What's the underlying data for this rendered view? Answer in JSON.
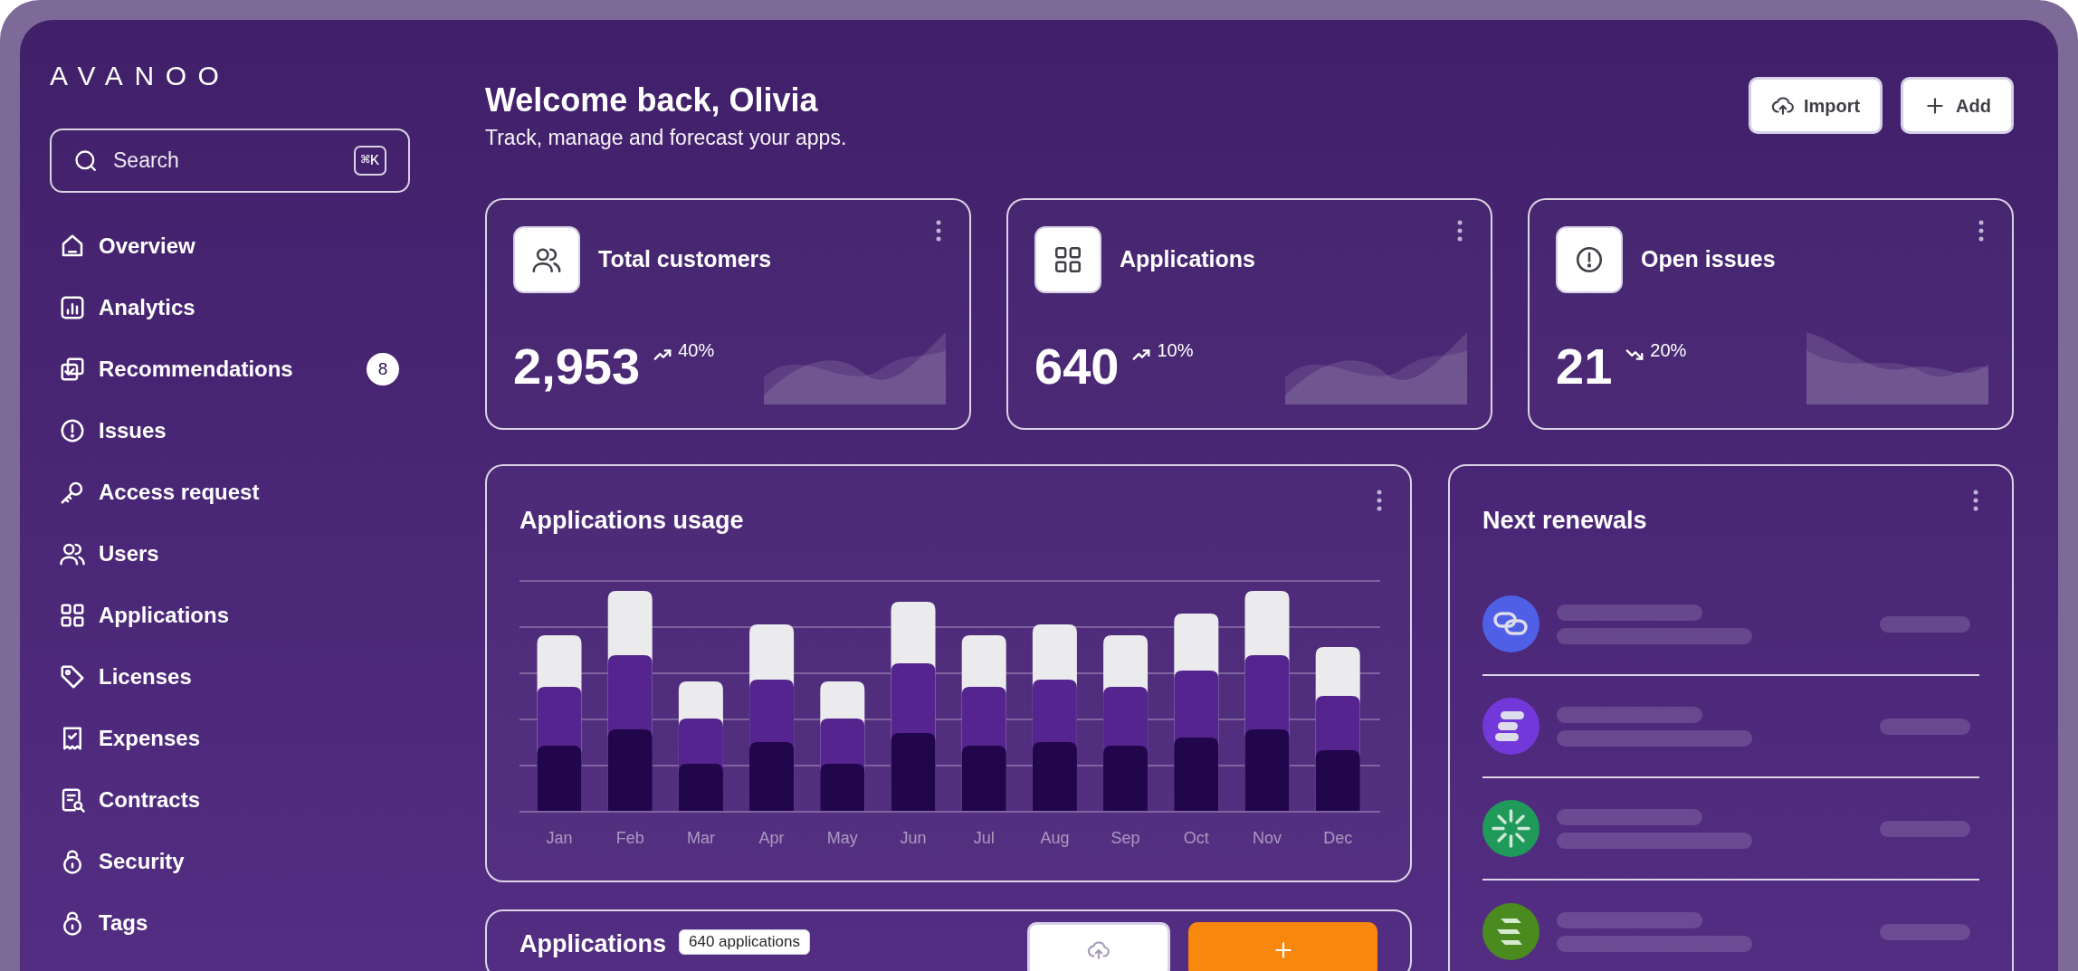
{
  "logo": "AVANOO",
  "search": {
    "placeholder": "Search",
    "shortcut": "⌘K"
  },
  "nav": [
    {
      "label": "Overview"
    },
    {
      "label": "Analytics"
    },
    {
      "label": "Recommendations",
      "badge": "8"
    },
    {
      "label": "Issues"
    },
    {
      "label": "Access request"
    },
    {
      "label": "Users"
    },
    {
      "label": "Applications"
    },
    {
      "label": "Licenses"
    },
    {
      "label": "Expenses"
    },
    {
      "label": "Contracts"
    },
    {
      "label": "Security"
    },
    {
      "label": "Tags"
    }
  ],
  "header": {
    "title": "Welcome back, Olivia",
    "subtitle": "Track, manage and forecast your apps.",
    "buttons": [
      {
        "label": "Import",
        "kind": "import"
      },
      {
        "label": "Add",
        "kind": "add"
      }
    ]
  },
  "stats": [
    {
      "title": "Total customers",
      "value": "2,953",
      "change": "40%",
      "rising": true
    },
    {
      "title": "Applications",
      "value": "640",
      "change": "10%",
      "rising": true
    },
    {
      "title": "Open issues",
      "value": "21",
      "change": "20%",
      "rising": false
    }
  ],
  "usage": {
    "title": "Applications usage",
    "months": [
      "Jan",
      "Feb",
      "Mar",
      "Apr",
      "May",
      "Jun",
      "Jul",
      "Aug",
      "Sep",
      "Oct",
      "Nov",
      "Dec"
    ]
  },
  "renewals": {
    "title": "Next renewals",
    "items": [
      {
        "kind": "chain",
        "color": "#4f5fe6"
      },
      {
        "kind": "s",
        "color": "#7338d9"
      },
      {
        "kind": "burst",
        "color": "#1f9a5a"
      },
      {
        "kind": "stripes",
        "color": "#4b8a1f"
      }
    ]
  },
  "applications": {
    "title": "Applications",
    "count": "640 applications",
    "buttons": [
      {
        "kind": "import"
      },
      {
        "kind": "add"
      }
    ]
  }
}
